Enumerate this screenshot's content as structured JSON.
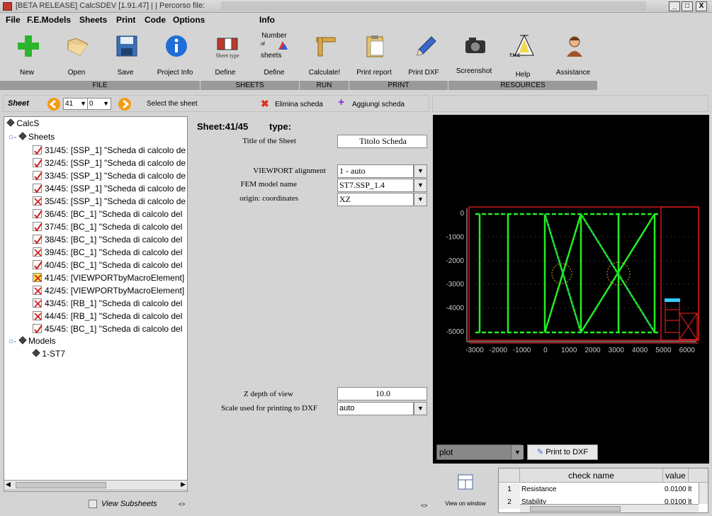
{
  "window": {
    "title": "[BETA RELEASE] CalcSDEV [1.91.47] | | Percorso file:",
    "min": "_",
    "max": "□",
    "close": "X"
  },
  "menu": [
    "File",
    "F.E.Models",
    "Sheets",
    "Print",
    "Code",
    "Options",
    "Info"
  ],
  "toolbar": {
    "items": [
      {
        "label": "New",
        "icon": "plus-icon"
      },
      {
        "label": "Open",
        "icon": "folder-icon"
      },
      {
        "label": "Save",
        "icon": "floppy-icon"
      },
      {
        "label": "Project Info",
        "icon": "info-icon"
      },
      {
        "label": "Define",
        "icon": "sheet-type-icon",
        "sub": "Sheet type"
      },
      {
        "label": "Define",
        "icon": "number-of-sheets-icon",
        "sub_top": "Number",
        "sub_mid": "of",
        "sub_bot": "sheets"
      },
      {
        "label": "Calculate!",
        "icon": "ruler-icon"
      },
      {
        "label": "Print report",
        "icon": "clipboard-icon"
      },
      {
        "label": "Print DXF",
        "icon": "pen-icon"
      },
      {
        "label": "Screenshot",
        "icon": "camera-icon"
      },
      {
        "label": "Help",
        "icon": "help-tent-icon",
        "sub": "T.M.E"
      },
      {
        "label": "Assistance",
        "icon": "assistant-icon"
      }
    ],
    "groups": [
      "FILE",
      "SHEETS",
      "RUN",
      "PRINT",
      "RESOURCES"
    ]
  },
  "sheetbar": {
    "label": "Sheet",
    "sheet_num": "41",
    "sub_num": "0",
    "select_label": "Select the sheet",
    "delete_label": "Elimina scheda",
    "add_label": "Aggiungi scheda"
  },
  "tree": {
    "root": "CalcS",
    "sheets_label": "Sheets",
    "sheets": [
      {
        "text": "31/45: [SSP_1] \"Scheda di calcolo de",
        "state": "check"
      },
      {
        "text": "32/45: [SSP_1] \"Scheda di calcolo de",
        "state": "check"
      },
      {
        "text": "33/45: [SSP_1] \"Scheda di calcolo de",
        "state": "check"
      },
      {
        "text": "34/45: [SSP_1] \"Scheda di calcolo de",
        "state": "check"
      },
      {
        "text": "35/45: [SSP_1] \"Scheda di calcolo de",
        "state": "cross"
      },
      {
        "text": "36/45: [BC_1] \"Scheda di calcolo del",
        "state": "check"
      },
      {
        "text": "37/45: [BC_1] \"Scheda di calcolo del",
        "state": "check"
      },
      {
        "text": "38/45: [BC_1] \"Scheda di calcolo del",
        "state": "check"
      },
      {
        "text": "39/45: [BC_1] \"Scheda di calcolo del",
        "state": "cross"
      },
      {
        "text": "40/45: [BC_1] \"Scheda di calcolo del",
        "state": "check"
      },
      {
        "text": "41/45: [VIEWPORTbyMacroElement]",
        "state": "selected"
      },
      {
        "text": "42/45: [VIEWPORTbyMacroElement]",
        "state": "cross"
      },
      {
        "text": "43/45: [RB_1] \"Scheda di calcolo del",
        "state": "cross"
      },
      {
        "text": "44/45: [RB_1] \"Scheda di calcolo del",
        "state": "cross"
      },
      {
        "text": "45/45: [BC_1] \"Scheda di calcolo del",
        "state": "check"
      }
    ],
    "models_label": "Models",
    "models": [
      "1-ST7"
    ],
    "view_subsheets": "View Subsheets",
    "arrows": "<>"
  },
  "form": {
    "header": "Sheet:41/45",
    "type_label": "type:",
    "title_label": "Title of the Sheet",
    "title_value": "Titolo Scheda",
    "viewport_label": "VIEWPORT alignment",
    "viewport_value": "1 - auto",
    "fem_label": "FEM model name",
    "fem_value": "ST7.SSP_1.4",
    "origin_label": "origin: coordinates",
    "origin_value": "XZ",
    "zdepth_label": "Z depth of view",
    "zdepth_value": "10.0",
    "scale_label": "Scale used for printing to DXF",
    "scale_value": "auto",
    "arrows": "<>"
  },
  "plot": {
    "y_ticks": [
      "0",
      "-1000",
      "-2000",
      "-3000",
      "-4000",
      "-5000"
    ],
    "x_ticks": [
      "-3000",
      "-2000",
      "-1000",
      "0",
      "1000",
      "2000",
      "3000",
      "4000",
      "5000",
      "6000"
    ],
    "select_value": "plot",
    "print_button": "Print to DXF",
    "colors": {
      "frame": "#ff2020",
      "members": "#22ee22",
      "axis": "#c8c8c8"
    }
  },
  "viewwin": {
    "label": "View on window"
  },
  "checktable": {
    "headers": [
      "",
      "check name",
      "value"
    ],
    "rows": [
      {
        "n": "1",
        "name": "Resistance",
        "value": "0.0100 lt"
      },
      {
        "n": "2",
        "name": "Stability",
        "value": "0.0100 lt"
      }
    ]
  }
}
